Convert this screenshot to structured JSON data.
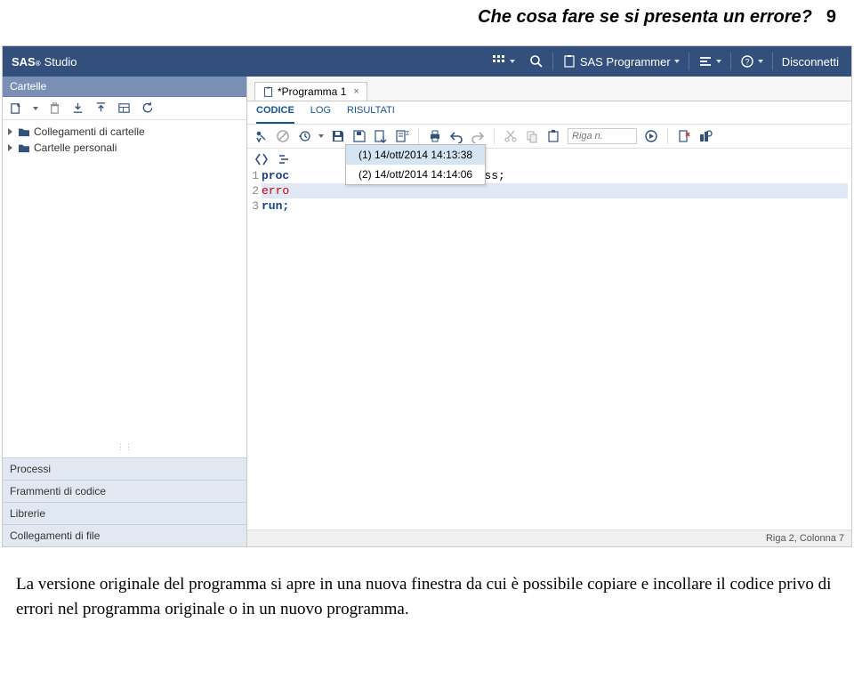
{
  "header": {
    "title": "Che cosa fare se si presenta un errore?",
    "page_number": "9"
  },
  "topbar": {
    "product_prefix": "SAS",
    "product_sup": "®",
    "product_sub": "Studio",
    "programmer_label": "SAS Programmer",
    "disconnect_label": "Disconnetti"
  },
  "sidebar": {
    "top_section": "Cartelle",
    "tree": [
      {
        "label": "Collegamenti di cartelle"
      },
      {
        "label": "Cartelle personali"
      }
    ],
    "bottom_sections": [
      "Processi",
      "Frammenti di codice",
      "Librerie",
      "Collegamenti di file"
    ]
  },
  "main": {
    "file_tab": "*Programma 1",
    "subtabs": {
      "code": "CODICE",
      "log": "LOG",
      "results": "RISULTATI"
    },
    "goto_placeholder": "Riga n.",
    "history": [
      {
        "label": "(1)  14/ott/2014 14:13:38",
        "selected": true
      },
      {
        "label": "(2)  14/ott/2014 14:14:06",
        "selected": false
      }
    ],
    "code": {
      "line1_kw": "proc",
      "line1_tail": ".class;",
      "line2_err": "erro",
      "line3_kw": "run;"
    },
    "status": "Riga 2, Colonna 7"
  },
  "body_text": "La versione originale del programma si apre in una nuova finestra da cui è possibile copiare e incollare il codice privo di errori nel programma originale o in un nuovo programma."
}
